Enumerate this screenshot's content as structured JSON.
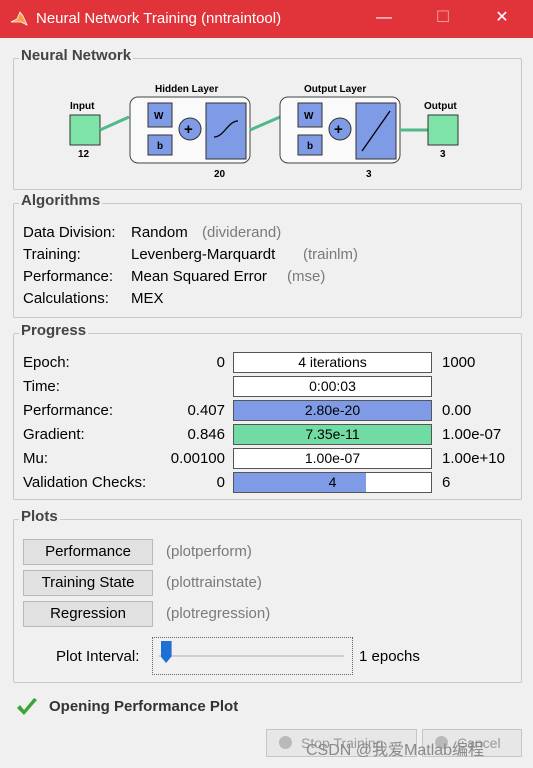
{
  "window": {
    "title": "Neural Network Training (nntraintool)",
    "minimize": "—",
    "maximize": "☐",
    "close": "✕"
  },
  "network": {
    "section": "Neural Network",
    "input_label": "Input",
    "input_size": "12",
    "hidden_label": "Hidden Layer",
    "hidden_size": "20",
    "output_layer_label": "Output Layer",
    "output_layer_size": "3",
    "output_label": "Output",
    "output_size": "3",
    "weight": "W",
    "bias": "b",
    "sum": "+"
  },
  "algorithms": {
    "section": "Algorithms",
    "rows": [
      {
        "label": "Data Division:",
        "value": "Random",
        "fn": "(dividerand)"
      },
      {
        "label": "Training:",
        "value": "Levenberg-Marquardt",
        "fn": "(trainlm)"
      },
      {
        "label": "Performance:",
        "value": "Mean Squared Error",
        "fn": "(mse)"
      },
      {
        "label": "Calculations:",
        "value": "MEX",
        "fn": ""
      }
    ]
  },
  "progress": {
    "section": "Progress",
    "rows": [
      {
        "label": "Epoch:",
        "start": "0",
        "value": "4 iterations",
        "end": "1000",
        "fill": 0,
        "color": "#ffffff"
      },
      {
        "label": "Time:",
        "start": "",
        "value": "0:00:03",
        "end": "",
        "fill": 0,
        "color": "#ffffff"
      },
      {
        "label": "Performance:",
        "start": "0.407",
        "value": "2.80e-20",
        "end": "0.00",
        "fill": 1.0,
        "color": "#7f9be6"
      },
      {
        "label": "Gradient:",
        "start": "0.846",
        "value": "7.35e-11",
        "end": "1.00e-07",
        "fill": 1.0,
        "color": "#70dca4"
      },
      {
        "label": "Mu:",
        "start": "0.00100",
        "value": "1.00e-07",
        "end": "1.00e+10",
        "fill": 0,
        "color": "#ffffff"
      },
      {
        "label": "Validation Checks:",
        "start": "0",
        "value": "4",
        "end": "6",
        "fill": 0.67,
        "color": "#7f9be6"
      }
    ]
  },
  "plots": {
    "section": "Plots",
    "buttons": [
      {
        "label": "Performance",
        "fn": "(plotperform)"
      },
      {
        "label": "Training State",
        "fn": "(plottrainstate)"
      },
      {
        "label": "Regression",
        "fn": "(plotregression)"
      }
    ],
    "interval_label": "Plot Interval:",
    "interval_value": "1 epochs",
    "interval_fraction": 0.02
  },
  "status": {
    "text": "Opening Performance Plot"
  },
  "footer": {
    "stop_label": "Stop Training",
    "cancel_label": "Cancel",
    "watermark": "CSDN @我爱Matlab编程"
  },
  "colors": {
    "titlebar": "#e0343a",
    "accent_blue": "#7f9be6",
    "accent_green": "#70dca4",
    "check": "#3aa63a"
  }
}
